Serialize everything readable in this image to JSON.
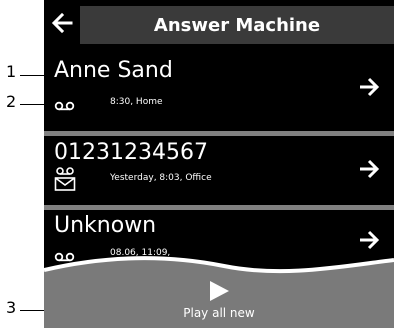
{
  "header": {
    "title": "Answer Machine"
  },
  "messages": [
    {
      "name": "Anne Sand",
      "details": "8:30, Home",
      "icon": "voicemail-icon"
    },
    {
      "name": "01231234567",
      "details": "Yesterday, 8:03, Office",
      "icon": "new-message-icon"
    },
    {
      "name": "Unknown",
      "details": "08.06, 11:09,",
      "icon": "voicemail-icon"
    }
  ],
  "footer": {
    "play_all_label": "Play all new"
  },
  "callouts": {
    "c1": "1",
    "c2": "2",
    "c3": "3"
  },
  "colors": {
    "background": "#000000",
    "title_bar": "#3a3a3a",
    "divider": "#808080",
    "footer": "#7a7a7a"
  }
}
